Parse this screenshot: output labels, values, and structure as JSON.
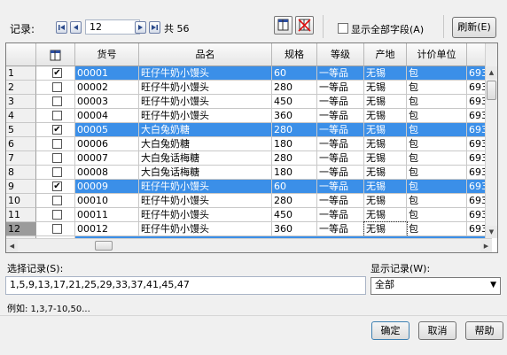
{
  "toolbar": {
    "record_label": "记录:",
    "current_record": "12",
    "total_label": "共 56",
    "show_all_fields_label": "显示全部字段(A)",
    "refresh_label": "刷新(E)"
  },
  "grid": {
    "columns": [
      "货号",
      "品名",
      "规格",
      "等级",
      "产地",
      "计价单位",
      ""
    ],
    "rows": [
      {
        "num": "1",
        "checked": true,
        "sel": true,
        "code": "00001",
        "name": "旺仔牛奶小馒头",
        "spec": "60",
        "grade": "一等品",
        "origin": "无锡",
        "unit": "包",
        "extra": "693"
      },
      {
        "num": "2",
        "checked": false,
        "sel": false,
        "code": "00002",
        "name": "旺仔牛奶小馒头",
        "spec": "280",
        "grade": "一等品",
        "origin": "无锡",
        "unit": "包",
        "extra": "693"
      },
      {
        "num": "3",
        "checked": false,
        "sel": false,
        "code": "00003",
        "name": "旺仔牛奶小馒头",
        "spec": "450",
        "grade": "一等品",
        "origin": "无锡",
        "unit": "包",
        "extra": "693"
      },
      {
        "num": "4",
        "checked": false,
        "sel": false,
        "code": "00004",
        "name": "旺仔牛奶小馒头",
        "spec": "360",
        "grade": "一等品",
        "origin": "无锡",
        "unit": "包",
        "extra": "693"
      },
      {
        "num": "5",
        "checked": true,
        "sel": true,
        "code": "00005",
        "name": "大白兔奶糖",
        "spec": "280",
        "grade": "一等品",
        "origin": "无锡",
        "unit": "包",
        "extra": "693"
      },
      {
        "num": "6",
        "checked": false,
        "sel": false,
        "code": "00006",
        "name": "大白兔奶糖",
        "spec": "180",
        "grade": "一等品",
        "origin": "无锡",
        "unit": "包",
        "extra": "693"
      },
      {
        "num": "7",
        "checked": false,
        "sel": false,
        "code": "00007",
        "name": "大白兔话梅糖",
        "spec": "280",
        "grade": "一等品",
        "origin": "无锡",
        "unit": "包",
        "extra": "693"
      },
      {
        "num": "8",
        "checked": false,
        "sel": false,
        "code": "00008",
        "name": "大白兔话梅糖",
        "spec": "180",
        "grade": "一等品",
        "origin": "无锡",
        "unit": "包",
        "extra": "693"
      },
      {
        "num": "9",
        "checked": true,
        "sel": true,
        "code": "00009",
        "name": "旺仔牛奶小馒头",
        "spec": "60",
        "grade": "一等品",
        "origin": "无锡",
        "unit": "包",
        "extra": "693"
      },
      {
        "num": "10",
        "checked": false,
        "sel": false,
        "code": "00010",
        "name": "旺仔牛奶小馒头",
        "spec": "280",
        "grade": "一等品",
        "origin": "无锡",
        "unit": "包",
        "extra": "693"
      },
      {
        "num": "11",
        "checked": false,
        "sel": false,
        "code": "00011",
        "name": "旺仔牛奶小馒头",
        "spec": "450",
        "grade": "一等品",
        "origin": "无锡",
        "unit": "包",
        "extra": "693"
      },
      {
        "num": "12",
        "checked": false,
        "sel": false,
        "code": "00012",
        "name": "旺仔牛奶小馒头",
        "spec": "360",
        "grade": "一等品",
        "origin": "无锡",
        "unit": "包",
        "extra": "693"
      }
    ]
  },
  "selection": {
    "label": "选择记录(S):",
    "value": "1,5,9,13,17,21,25,29,33,37,41,45,47",
    "example": "例如:  1,3,7-10,50..."
  },
  "display": {
    "label": "显示记录(W):",
    "selected": "全部"
  },
  "buttons": {
    "ok": "确定",
    "cancel": "取消",
    "help": "帮助"
  },
  "colors": {
    "selected_row": "#3b8fe8",
    "background": "#f0f0f0"
  }
}
